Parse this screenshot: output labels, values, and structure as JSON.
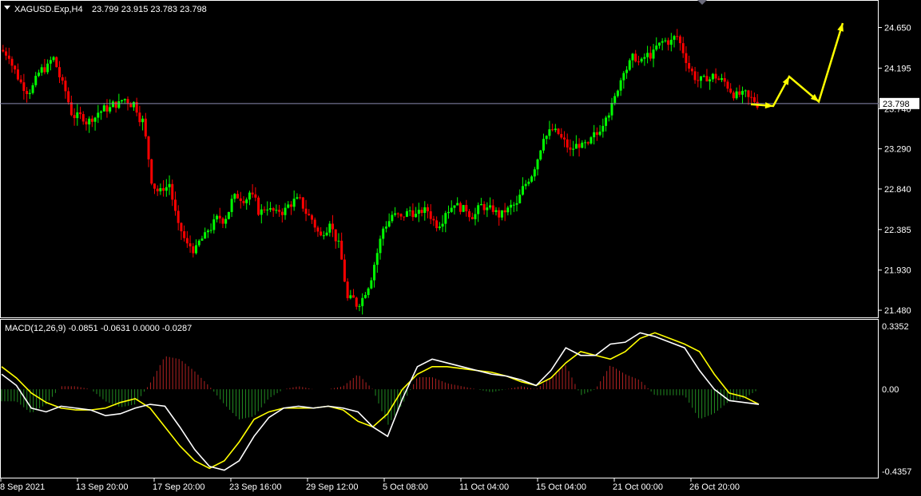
{
  "header": {
    "symbol_timeframe": "XAGUSD.Exp,H4",
    "ohlc": "23.799 23.915 23.783 23.798"
  },
  "macd_header": {
    "label": "MACD(12,26,9) -0.0851 -0.0631 0.0000 -0.0287"
  },
  "current_price_label": "23.798",
  "colors": {
    "background": "#000000",
    "bull": "#00ff00",
    "bear": "#ff0000",
    "macd_line": "#ffffff",
    "signal_line": "#ffff00",
    "hist_pos": "#b22222",
    "hist_neg": "#228b22",
    "arrows": "#ffff00",
    "price_line": "#8a8ab0",
    "frame": "#ffffff"
  },
  "chart_data": [
    {
      "type": "candlestick",
      "ylim": [
        21.4,
        24.95
      ],
      "y_ticks": [
        "24.650",
        "24.195",
        "23.740",
        "23.290",
        "22.840",
        "22.385",
        "21.930",
        "21.480"
      ],
      "x_ticks": [
        "8 Sep 2021",
        "13 Sep 20:00",
        "17 Sep 20:00",
        "23 Sep 16:00",
        "29 Sep 12:00",
        "5 Oct 08:00",
        "11 Oct 04:00",
        "15 Oct 04:00",
        "21 Oct 00:00",
        "26 Oct 20:00"
      ],
      "close_series": [
        24.35,
        24.1,
        23.95,
        24.05,
        24.2,
        24.3,
        24.0,
        23.7,
        23.65,
        23.6,
        23.7,
        23.75,
        23.8,
        23.85,
        23.8,
        23.6,
        22.95,
        22.8,
        22.9,
        22.4,
        22.2,
        22.15,
        22.3,
        22.45,
        22.5,
        22.7,
        22.75,
        22.8,
        22.6,
        22.65,
        22.55,
        22.6,
        22.7,
        22.65,
        22.5,
        22.3,
        22.5,
        22.2,
        21.6,
        21.55,
        21.7,
        22.0,
        22.4,
        22.55,
        22.5,
        22.6,
        22.55,
        22.6,
        22.45,
        22.6,
        22.7,
        22.6,
        22.55,
        22.65,
        22.6,
        22.55,
        22.6,
        22.65,
        22.9,
        23.1,
        23.45,
        23.5,
        23.4,
        23.25,
        23.35,
        23.3,
        23.45,
        23.7,
        23.85,
        24.2,
        24.3,
        24.25,
        24.35,
        24.45,
        24.5,
        24.55,
        24.3,
        24.1,
        24.05,
        24.1,
        24.05,
        23.95,
        23.9,
        23.85,
        23.8
      ],
      "projection_points": [
        23.79,
        23.77,
        24.1,
        23.82,
        24.7
      ],
      "current_price": 23.798
    },
    {
      "type": "macd",
      "ylim": [
        -0.4357,
        0.3352
      ],
      "y_ticks": [
        "0.3352",
        "0.00",
        "-0.4357"
      ],
      "macd_series": [
        0.08,
        0.02,
        -0.1,
        -0.12,
        -0.09,
        -0.1,
        -0.11,
        -0.14,
        -0.13,
        -0.1,
        -0.08,
        -0.09,
        -0.2,
        -0.32,
        -0.41,
        -0.43,
        -0.38,
        -0.25,
        -0.15,
        -0.1,
        -0.09,
        -0.1,
        -0.09,
        -0.1,
        -0.12,
        -0.2,
        -0.25,
        -0.05,
        0.12,
        0.16,
        0.14,
        0.12,
        0.1,
        0.08,
        0.07,
        0.05,
        0.02,
        0.1,
        0.22,
        0.18,
        0.18,
        0.24,
        0.25,
        0.3,
        0.28,
        0.25,
        0.22,
        0.1,
        0.0,
        -0.06,
        -0.07,
        -0.08
      ],
      "signal_series": [
        0.12,
        0.06,
        -0.02,
        -0.07,
        -0.1,
        -0.11,
        -0.11,
        -0.1,
        -0.07,
        -0.05,
        -0.1,
        -0.2,
        -0.3,
        -0.38,
        -0.42,
        -0.38,
        -0.28,
        -0.16,
        -0.12,
        -0.1,
        -0.1,
        -0.1,
        -0.09,
        -0.11,
        -0.17,
        -0.2,
        -0.13,
        0.0,
        0.08,
        0.12,
        0.12,
        0.11,
        0.1,
        0.09,
        0.07,
        0.04,
        0.02,
        0.06,
        0.14,
        0.2,
        0.18,
        0.16,
        0.2,
        0.27,
        0.3,
        0.27,
        0.24,
        0.2,
        0.08,
        -0.02,
        -0.04,
        -0.08
      ]
    }
  ]
}
